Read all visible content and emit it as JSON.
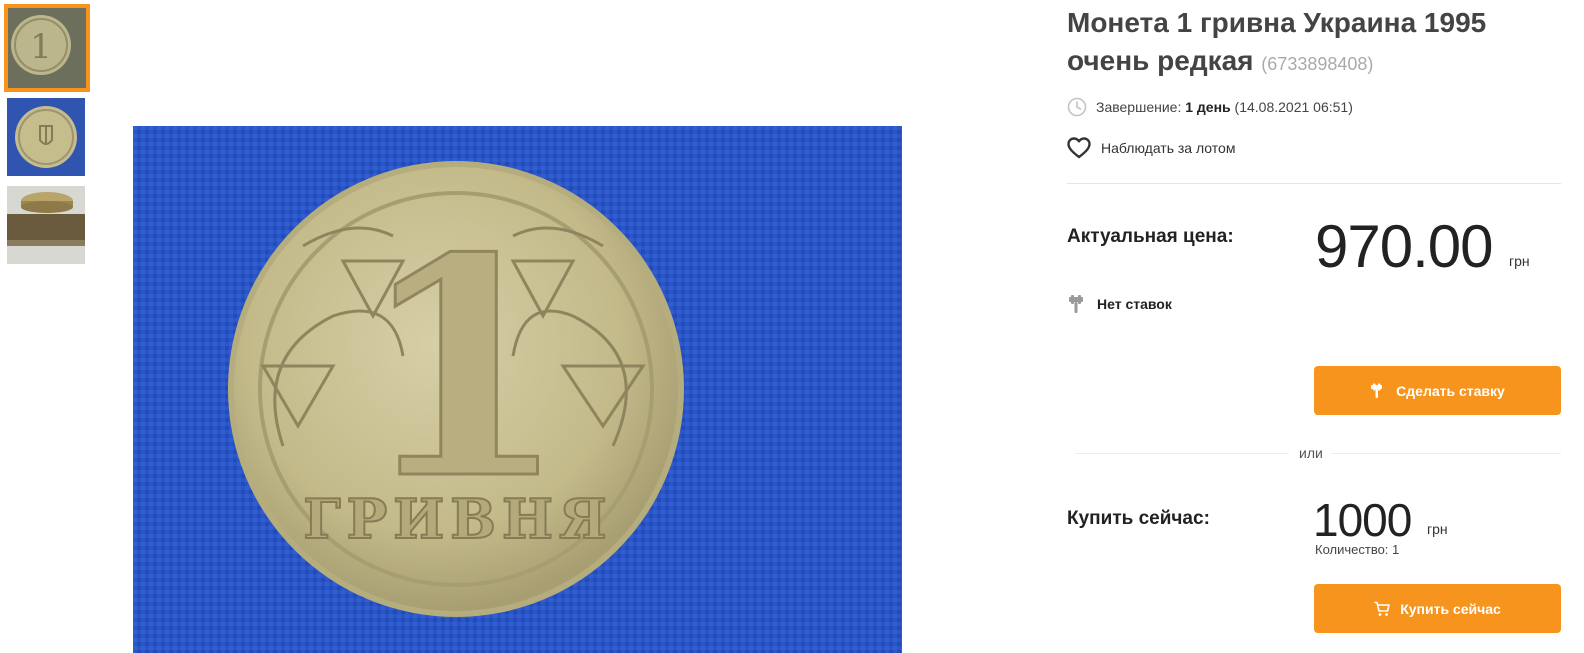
{
  "lot": {
    "title": "Монета 1 гривна Украина 1995 очень редкая",
    "id_text": "(6733898408)"
  },
  "ending": {
    "label": "Завершение:",
    "remaining": "1 день",
    "datetime": "(14.08.2021 06:51)"
  },
  "watch_label": "Наблюдать за лотом",
  "current_price": {
    "label": "Актуальная цена:",
    "value": "970.00",
    "currency": "грн"
  },
  "bids_status": "Нет ставок",
  "bid_button_label": "Сделать ставку",
  "or_label": "или",
  "buy_now": {
    "label": "Купить сейчас:",
    "value": "1000",
    "currency": "грн",
    "quantity": "Количество: 1"
  },
  "buy_button_label": "Купить сейчас",
  "coin_inscription": "ГРИВНЯ",
  "coin_denomination": "1",
  "thumbnails": [
    {
      "name": "coin-reverse",
      "active": true
    },
    {
      "name": "coin-obverse",
      "active": false
    },
    {
      "name": "coin-edge",
      "active": false
    }
  ],
  "colors": {
    "accent": "#f7941d",
    "photo_background": "#2a56c8",
    "coin": "#c9bf8f"
  },
  "icons": [
    "clock-icon",
    "heart-icon",
    "gavel-icon",
    "cart-icon"
  ]
}
